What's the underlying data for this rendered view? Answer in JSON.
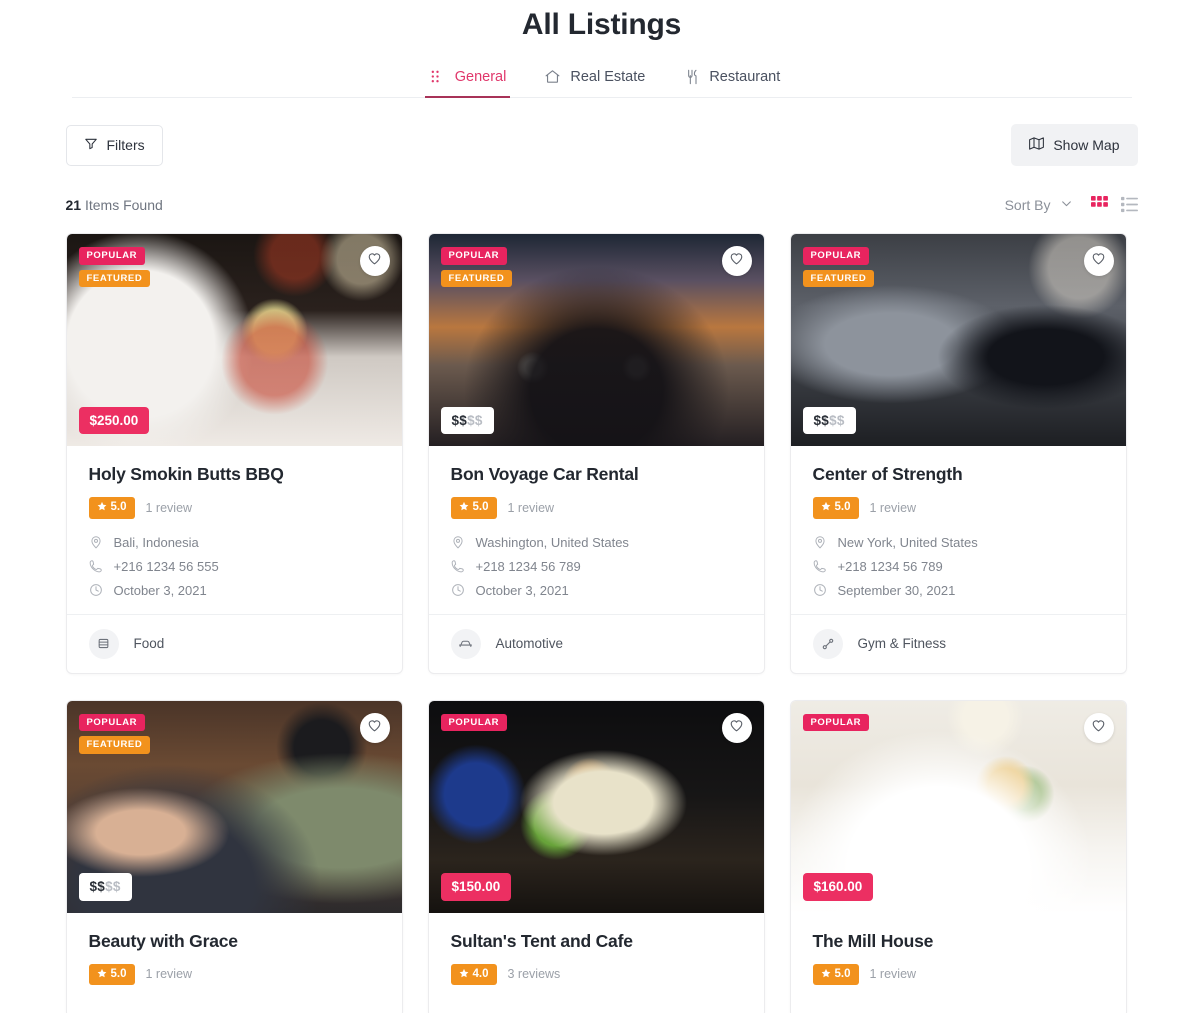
{
  "header": {
    "title": "All Listings",
    "tabs": [
      {
        "label": "General",
        "icon": "grid-dots-icon",
        "active": true
      },
      {
        "label": "Real Estate",
        "icon": "home-icon",
        "active": false
      },
      {
        "label": "Restaurant",
        "icon": "cutlery-icon",
        "active": false
      }
    ]
  },
  "toolbar": {
    "filters_label": "Filters",
    "filters_icon": "funnel-icon",
    "show_map_label": "Show Map",
    "show_map_icon": "map-icon"
  },
  "results": {
    "count": "21",
    "count_label": "Items Found",
    "sort_label": "Sort By",
    "sort_icon": "chevron-down-icon",
    "grid_view_icon": "grid-view-icon",
    "list_view_icon": "list-view-icon",
    "grid_view_active": true
  },
  "colors": {
    "accent_pink": "#e8245f",
    "accent_orange": "#f2921d",
    "price_pink": "#ec2f62",
    "tab_active": "#e0376b",
    "text_dark": "#232830",
    "text_muted": "#80858e"
  },
  "listings": [
    {
      "title": "Holy Smokin Butts BBQ",
      "badges": [
        "POPULAR",
        "FEATURED"
      ],
      "price_type": "money",
      "price": "$250.00",
      "price_active": 0,
      "rating": "5.0",
      "reviews": "1 review",
      "location": "Bali, Indonesia",
      "phone": "+216 1234 56 555",
      "date": "October 3, 2021",
      "category": "Food",
      "category_icon": "food-icon",
      "photo": "ph-cupcake"
    },
    {
      "title": "Bon Voyage Car Rental",
      "badges": [
        "POPULAR",
        "FEATURED"
      ],
      "price_type": "range",
      "price": "$$$$",
      "price_active": 2,
      "rating": "5.0",
      "reviews": "1 review",
      "location": "Washington, United States",
      "phone": "+218 1234 56 789",
      "date": "October 3, 2021",
      "category": "Automotive",
      "category_icon": "car-icon",
      "photo": "ph-truck"
    },
    {
      "title": "Center of Strength",
      "badges": [
        "POPULAR",
        "FEATURED"
      ],
      "price_type": "range",
      "price": "$$$$",
      "price_active": 2,
      "rating": "5.0",
      "reviews": "1 review",
      "location": "New York, United States",
      "phone": "+218 1234 56 789",
      "date": "September 30, 2021",
      "category": "Gym & Fitness",
      "category_icon": "dumbbell-icon",
      "photo": "ph-gym"
    },
    {
      "title": "Beauty with Grace",
      "badges": [
        "POPULAR",
        "FEATURED"
      ],
      "price_type": "range",
      "price": "$$$$",
      "price_active": 2,
      "rating": "5.0",
      "reviews": "1 review",
      "location": "",
      "phone": "",
      "date": "",
      "category": "",
      "category_icon": "",
      "photo": "ph-barber"
    },
    {
      "title": "Sultan's Tent and Cafe",
      "badges": [
        "POPULAR"
      ],
      "price_type": "money",
      "price": "$150.00",
      "price_active": 0,
      "rating": "4.0",
      "reviews": "3 reviews",
      "location": "",
      "phone": "",
      "date": "",
      "category": "",
      "category_icon": "",
      "photo": "ph-salad"
    },
    {
      "title": "The Mill House",
      "badges": [
        "POPULAR"
      ],
      "price_type": "money",
      "price": "$160.00",
      "price_active": 0,
      "rating": "5.0",
      "reviews": "1 review",
      "location": "",
      "phone": "",
      "date": "",
      "category": "",
      "category_icon": "",
      "photo": "ph-bedroom"
    }
  ]
}
